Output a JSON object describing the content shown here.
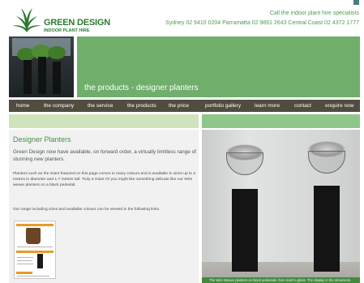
{
  "header": {
    "logo_title": "GREEN DESIGN",
    "logo_subtitle": "INDOOR PLANT HIRE",
    "tagline": "Call the indoor plant hire specialists",
    "phones": "Sydney 02 9410 0204   Parramatta 02 9891 2643   Central Coast 02 4372 1777"
  },
  "banner": {
    "title": "the products - designer planters"
  },
  "nav": {
    "items": [
      "home",
      "the company",
      "the service",
      "the products",
      "the price",
      "portfolio gallery",
      "learn more",
      "contact",
      "enquire now"
    ]
  },
  "content": {
    "heading": "Designer Planters",
    "intro": "Green Design now have available, on forward order, a virtually limitless range of stunning new planters.",
    "paragraph": "Planters such as the Giant featured on this page comes in many colours and is available in sizes up to 2 metres in diameter and 1.7 metres tall. Truly a Giant Or you might like something delicate like our Wire weave planters on a black pedestal.",
    "paragraph2": "Our range including sizes and available colours can be viewed in the following links."
  },
  "photo": {
    "caption": "The Wire Weave planters on black pedestals, from matt to gloss. The display in the showroom."
  },
  "colors": {
    "brand_green": "#2c7a30",
    "banner_green": "#6fae6b",
    "nav_bg": "#514c40"
  }
}
